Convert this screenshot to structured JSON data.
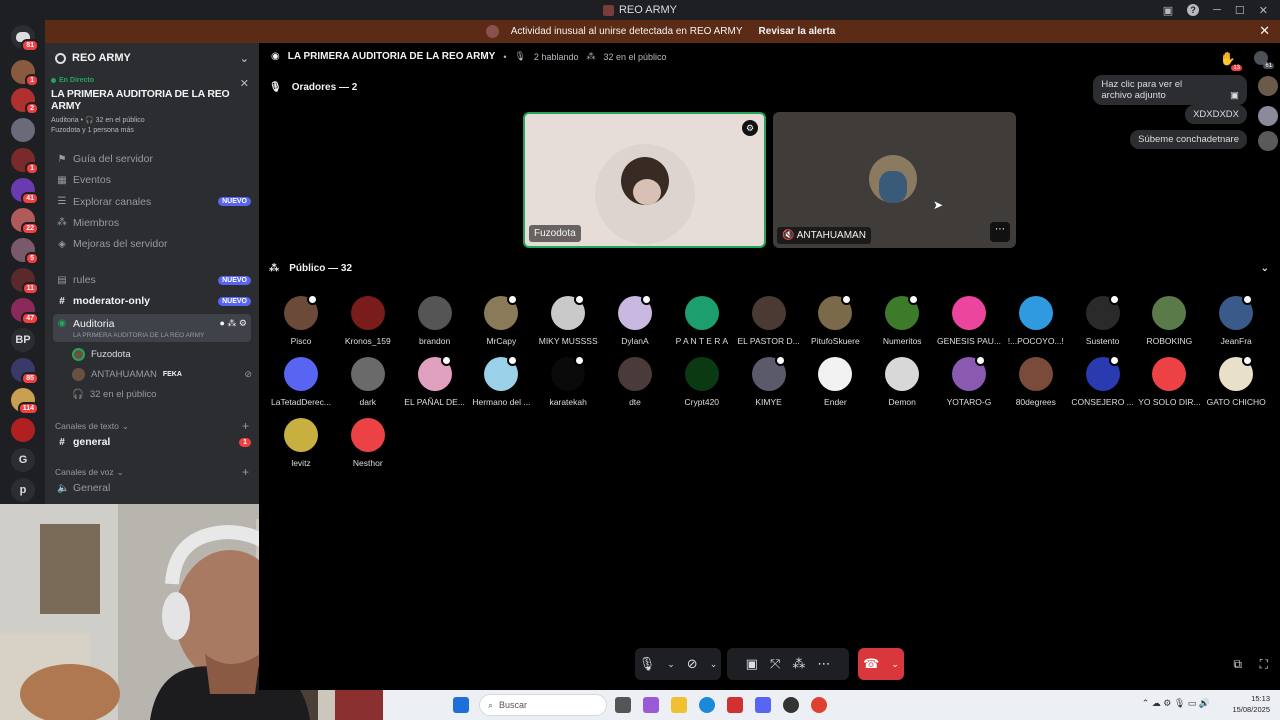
{
  "window": {
    "title": "REO ARMY"
  },
  "alert": {
    "message": "Actividad inusual al unirse detectada en REO ARMY",
    "action": "Revisar la alerta"
  },
  "server_rail": {
    "dm_badge": "81",
    "servers": [
      {
        "badge": "1"
      },
      {
        "badge": "2"
      },
      {
        "badge": ""
      },
      {
        "badge": "1"
      },
      {
        "badge": "41"
      },
      {
        "badge": "22"
      },
      {
        "badge": "5"
      },
      {
        "badge": "11"
      },
      {
        "badge": "47"
      },
      {
        "text": "BP",
        "badge": ""
      },
      {
        "badge": "85"
      },
      {
        "badge": "114"
      },
      {
        "badge": ""
      },
      {
        "text": "G",
        "badge": ""
      },
      {
        "text": "p",
        "badge": ""
      }
    ]
  },
  "guild": {
    "name": "REO ARMY",
    "live_label": "En Directo",
    "stage_name": "LA PRIMERA AUDITORIA DE LA REO ARMY",
    "stage_meta": "Auditoria • 🎧 32 en el público",
    "stage_meta2": "Fuzodota y 1 persona más",
    "menu": [
      {
        "label": "Guía del servidor",
        "icon": "signpost-icon"
      },
      {
        "label": "Eventos",
        "icon": "calendar-icon"
      },
      {
        "label": "Explorar canales",
        "icon": "browse-icon",
        "badge": "NUEVO"
      },
      {
        "label": "Miembros",
        "icon": "members-icon"
      },
      {
        "label": "Mejoras del servidor",
        "icon": "boost-icon"
      }
    ],
    "channels": [
      {
        "label": "rules",
        "icon": "rules-icon",
        "badge": "NUEVO"
      },
      {
        "label": "moderator-only",
        "icon": "hash-icon",
        "badge": "NUEVO"
      }
    ],
    "active_stage": {
      "label": "Auditoria",
      "sub": "LA PRIMERA AUDITORIA DE LA REO ARMY"
    },
    "stage_users": [
      {
        "name": "Fuzodota",
        "tag": ""
      },
      {
        "name": "ANTAHUAMAN",
        "tag": "FEKA"
      }
    ],
    "audience_line": "32 en el público",
    "text_category": "Canales de texto",
    "text_channel": "general",
    "text_channel_badge": "1",
    "voice_category": "Canales de voz",
    "voice_channel": "General"
  },
  "stage": {
    "title": "LA PRIMERA AUDITORIA DE LA REO ARMY",
    "speaking": "2 hablando",
    "audience": "32 en el público",
    "hand_badge": "13",
    "members_badge": "61",
    "speakers_title": "Oradores — 2",
    "speakers": [
      {
        "name": "Fuzodota",
        "bg": "#e6dcd8",
        "border": "#23a55a"
      },
      {
        "name": "ANTAHUAMAN",
        "bg": "#3f3c3a",
        "border": "transparent"
      }
    ],
    "audience_title": "Público — 32",
    "audience_list": [
      {
        "name": "Pisco",
        "color": "#6b4a3a",
        "st": true
      },
      {
        "name": "Kronos_159",
        "color": "#7a1c1c",
        "st": false
      },
      {
        "name": "brandon",
        "color": "#555",
        "st": false
      },
      {
        "name": "MrCapy",
        "color": "#8a7a5a",
        "st": true
      },
      {
        "name": "MIKY MUSSSS",
        "color": "#c9c9c9",
        "st": true
      },
      {
        "name": "DylanA",
        "color": "#c9b8e0",
        "st": true
      },
      {
        "name": "P A N T E R A",
        "color": "#1d9e6d",
        "st": false
      },
      {
        "name": "EL PASTOR D...",
        "color": "#4a3a33",
        "st": false
      },
      {
        "name": "PitufoSkuere",
        "color": "#7b6a4a",
        "st": true
      },
      {
        "name": "Numeritos",
        "color": "#3d7a2a",
        "st": true
      },
      {
        "name": "GENESIS PAU...",
        "color": "#eb459e",
        "st": false
      },
      {
        "name": "!...POCOYO...!",
        "color": "#2f9ae0",
        "st": false
      },
      {
        "name": "Sustento",
        "color": "#2a2a2a",
        "st": true
      },
      {
        "name": "ROBOKING",
        "color": "#5a7a4a",
        "st": false
      },
      {
        "name": "JeanFra",
        "color": "#3a5a8a",
        "st": true
      },
      {
        "name": "LaTetadDerec...",
        "color": "#5865f2",
        "st": false
      },
      {
        "name": "dark",
        "color": "#6a6a6a",
        "st": false
      },
      {
        "name": "EL PAÑAL DE...",
        "color": "#e0a0c0",
        "st": true
      },
      {
        "name": "Hermano del ...",
        "color": "#9ad0e8",
        "st": true
      },
      {
        "name": "karatekah",
        "color": "#0a0a0a",
        "st": true
      },
      {
        "name": "dte",
        "color": "#4a3a3a",
        "st": false
      },
      {
        "name": "Crypt420",
        "color": "#0b3a12",
        "st": false
      },
      {
        "name": "KIMYE",
        "color": "#5a5a6a",
        "st": true
      },
      {
        "name": "Ender",
        "color": "#f2f2f2",
        "st": false
      },
      {
        "name": "Demon",
        "color": "#d8d8d8",
        "st": false
      },
      {
        "name": "YOTARO-G",
        "color": "#8a5ab0",
        "st": true
      },
      {
        "name": "80degrees",
        "color": "#7a4a3a",
        "st": false
      },
      {
        "name": "CONSEJERO ...",
        "color": "#2a3ab0",
        "st": true
      },
      {
        "name": "YO SOLO DIR...",
        "color": "#ed4245",
        "st": false
      },
      {
        "name": "GATO CHICHO",
        "color": "#e8e0c8",
        "st": true
      },
      {
        "name": "levitz",
        "color": "#c8b040",
        "st": false
      },
      {
        "name": "Nesthor",
        "color": "#ed4245",
        "st": false
      }
    ]
  },
  "chat": [
    {
      "text": "Haz clic para ver el archivo adjunto"
    },
    {
      "text": "XDXDXDX"
    },
    {
      "text": "Súbeme conchadetnare"
    }
  ],
  "taskbar": {
    "search_placeholder": "Buscar",
    "time": "15:13",
    "date": "15/08/2025"
  }
}
